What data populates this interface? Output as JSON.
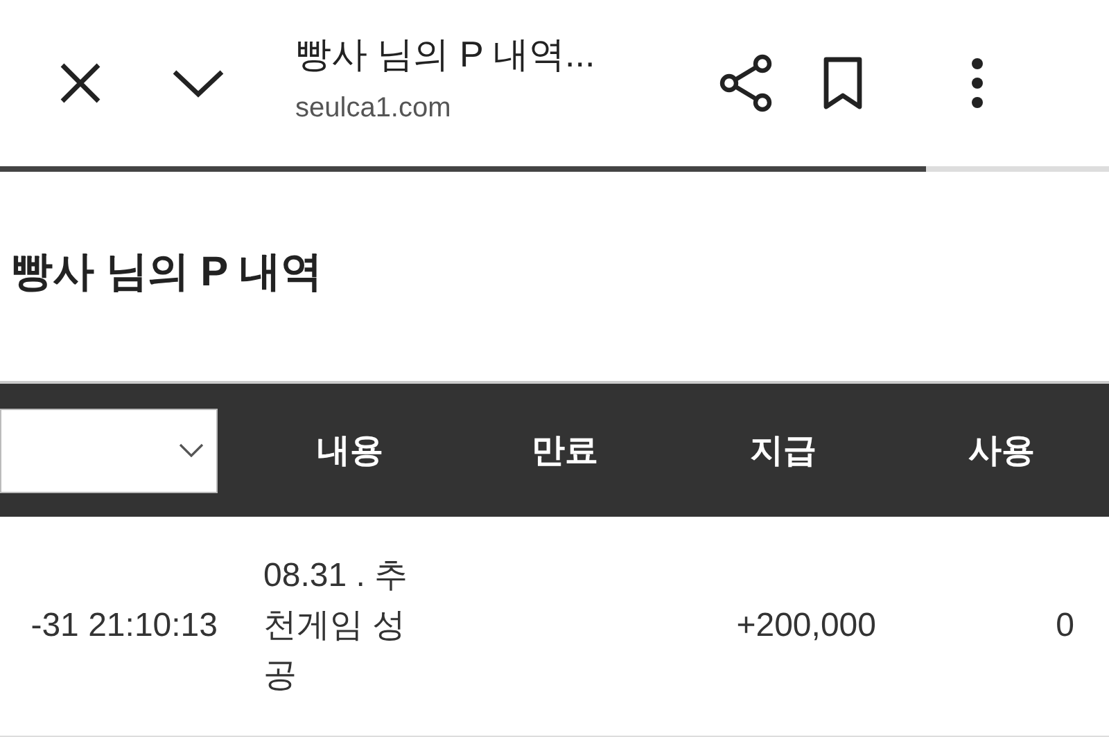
{
  "toolbar": {
    "title": "빵사 님의 P 내역...",
    "url": "seulca1.com"
  },
  "progress": {
    "level": 0.835
  },
  "heading": "빵사 님의 P 내역",
  "table": {
    "columns": [
      "내용",
      "만료",
      "지급",
      "사용"
    ],
    "rows": [
      {
        "column_1": "-31 21:10:13",
        "content": "08.31 . 추천게임 성공",
        "expiry": "",
        "paid": "+200,000",
        "used": "0"
      }
    ]
  }
}
